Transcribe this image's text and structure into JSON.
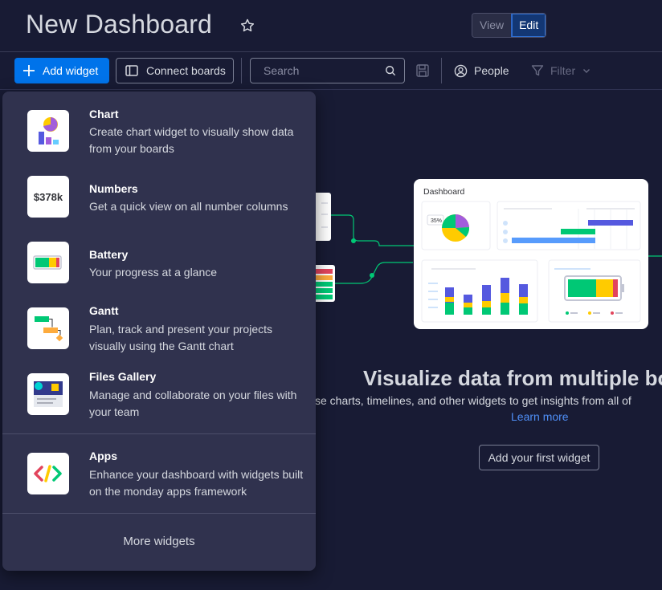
{
  "header": {
    "title": "New Dashboard",
    "view_label": "View",
    "edit_label": "Edit"
  },
  "toolbar": {
    "add_widget_label": "Add widget",
    "connect_boards_label": "Connect boards",
    "search_placeholder": "Search",
    "people_label": "People",
    "filter_label": "Filter"
  },
  "widget_menu": {
    "items": [
      {
        "title": "Chart",
        "description": "Create chart widget to visually show data from your boards",
        "icon": "chart-icon"
      },
      {
        "title": "Numbers",
        "description": "Get a quick view on all number columns",
        "icon": "numbers-icon",
        "icon_text": "$378k"
      },
      {
        "title": "Battery",
        "description": "Your progress at a glance",
        "icon": "battery-icon"
      },
      {
        "title": "Gantt",
        "description": "Plan, track and present your projects visually using the Gantt chart",
        "icon": "gantt-icon"
      },
      {
        "title": "Files Gallery",
        "description": "Manage and collaborate on your files with your team",
        "icon": "files-gallery-icon"
      },
      {
        "title": "Apps",
        "description": "Enhance your dashboard with widgets built on the monday apps framework",
        "icon": "apps-icon"
      }
    ],
    "more_label": "More widgets"
  },
  "empty_state": {
    "preview_title": "Dashboard",
    "preview_percent": "35%",
    "title": "Visualize data from multiple bo",
    "subtitle": "se charts, timelines, and other widgets to get insights from all of",
    "learn_more": "Learn more",
    "cta_label": "Add your first widget"
  },
  "colors": {
    "background": "#181b34",
    "menu": "#30324e",
    "primary": "#0073ea",
    "link": "#4f8ff7"
  }
}
